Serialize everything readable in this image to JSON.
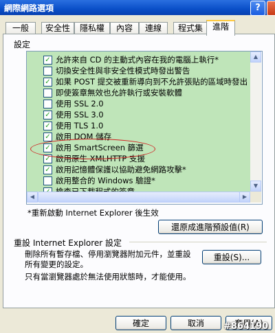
{
  "window": {
    "title": "網際網路選項",
    "help_glyph": "?"
  },
  "tabs": [
    "一般",
    "安全性",
    "隱私權",
    "內容",
    "連線",
    "程式集",
    "進階"
  ],
  "active_tab": "進階",
  "settings_label": "設定",
  "list_items": [
    {
      "checked": true,
      "label": "允許來自 CD 的主動式內容在我的電腦上執行*"
    },
    {
      "checked": false,
      "label": "切換安全性與非安全性模式時發出警告"
    },
    {
      "checked": true,
      "label": "如果 POST 提交被重新導向到不允許張貼的區域時發出"
    },
    {
      "checked": false,
      "label": "即使簽章無效也允許執行或安裝軟體"
    },
    {
      "checked": false,
      "label": "使用 SSL 2.0"
    },
    {
      "checked": true,
      "label": "使用 SSL 3.0"
    },
    {
      "checked": true,
      "label": "使用 TLS 1.0"
    },
    {
      "checked": true,
      "label": "啟用 DOM 儲存"
    },
    {
      "checked": true,
      "label": "啟用 SmartScreen 篩選"
    },
    {
      "checked": true,
      "label": "啟用原生 XMLHTTP 支援"
    },
    {
      "checked": true,
      "label": "啟用記憶體保護以協助避免網路攻擊*"
    },
    {
      "checked": false,
      "label": "啟用整合的 Windows 驗證*"
    },
    {
      "checked": true,
      "label": "檢查已下載程式的簽章"
    }
  ],
  "check_glyph": "✓",
  "scroll": {
    "up": "▲",
    "down": "▼",
    "left": "◀",
    "right": "▶"
  },
  "restart_note": "*重新啟動 Internet Explorer 後生效",
  "restore_button": "還原成進階預設值(R)",
  "reset_group": {
    "title": "重設 Internet Explorer 設定",
    "description": "刪除所有暫存檔、停用瀏覽器附加元件，並重設所有變更的設定。",
    "reset_button": "重設(S)...",
    "note": "只有當瀏覽器處於無法使用狀態時，才能使用。"
  },
  "footer": {
    "ok": "確定",
    "cancel": "取消",
    "apply": "套用(A)"
  },
  "watermark": "#864190",
  "annotation_color": "#d02020"
}
